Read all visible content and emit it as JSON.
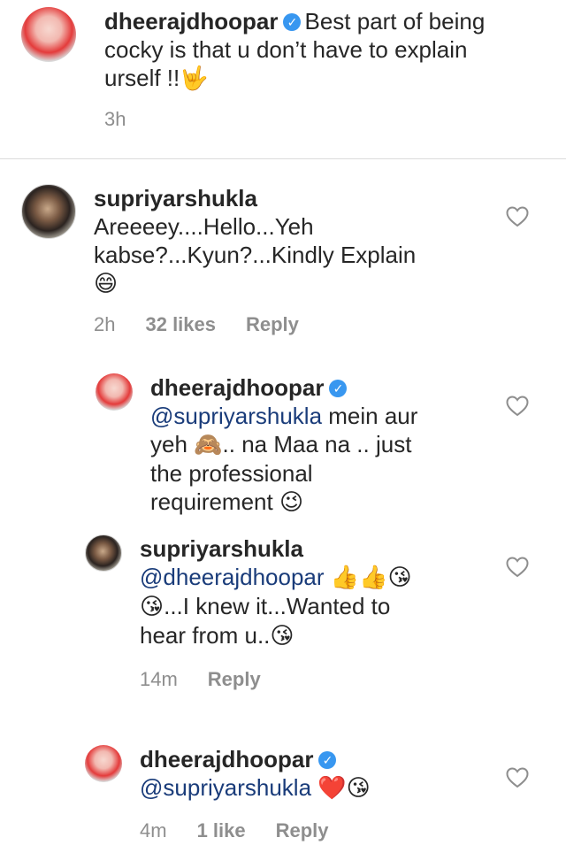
{
  "post": {
    "username": "dheerajdhoopar",
    "caption": "Best part of being cocky is that u don’t have to explain urself !!",
    "caption_emoji": "🤟",
    "time": "3h"
  },
  "comments": [
    {
      "username": "supriyarshukla",
      "text": "Areeeey....Hello...Yeh kabse?...Kyun?...Kindly Explain",
      "emoji": "😄",
      "time": "2h",
      "likes": "32 likes",
      "reply": "Reply"
    },
    {
      "username": "dheerajdhoopar",
      "mention": "@supriyarshukla",
      "text_a": " mein aur",
      "text_b": "yeh",
      "emoji_a": "🙈",
      "text_c": ".. na Maa na .. just",
      "text_d": "the professional",
      "text_e": "requirement",
      "emoji_b": "😉"
    },
    {
      "username": "supriyarshukla",
      "mention": "@dheerajdhoopar",
      "emoji_a": "👍👍😘",
      "emoji_b": "😘",
      "text_a": "...I knew it...Wanted to",
      "text_b": "hear from u..",
      "emoji_c": "😘",
      "time": "14m",
      "reply": "Reply"
    },
    {
      "username": "dheerajdhoopar",
      "mention": "@supriyarshukla",
      "emoji": "❤️😘",
      "time": "4m",
      "likes": "1 like",
      "reply": "Reply"
    }
  ],
  "icons": {
    "verified": "verified-badge-icon",
    "heart": "heart-outline-icon"
  },
  "colors": {
    "verified": "#3897f0",
    "mention": "#1a3c7a",
    "meta": "#8e8e8e"
  }
}
